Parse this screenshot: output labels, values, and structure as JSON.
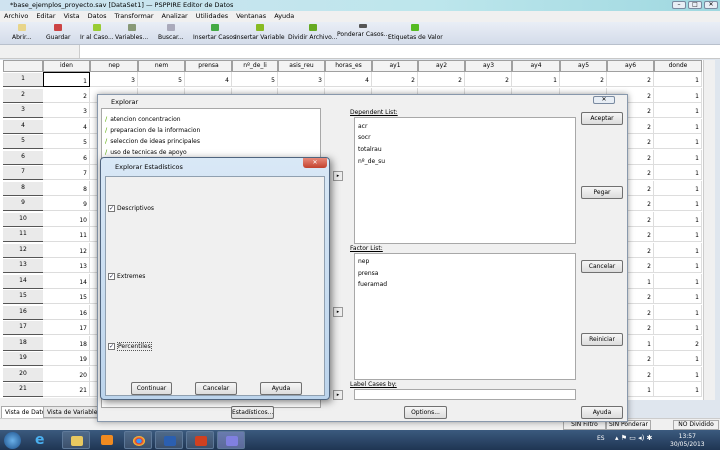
{
  "window": {
    "title": "*base_ejemplos_proyecto.sav [DataSet1] — PSPPIRE Editor de Datos"
  },
  "menu": [
    "Archivo",
    "Editar",
    "Vista",
    "Datos",
    "Transformar",
    "Analizar",
    "Utilidades",
    "Ventanas",
    "Ayuda"
  ],
  "toolbar": [
    "Abrir...",
    "Guardar",
    "Ir al Caso...",
    "Variables...",
    "Buscar...",
    "Insertar Casos",
    "Insertar Variable",
    "Dividir Archivo...",
    "Ponderar Casos...",
    "Etiquetas de Valor"
  ],
  "grid": {
    "columns": [
      "iden",
      "nep",
      "nem",
      "prensa",
      "nº_de_li",
      "asis_reu",
      "horas_es",
      "ay1",
      "ay2",
      "ay3",
      "ay4",
      "ay5",
      "ay6",
      "donde"
    ],
    "row1": [
      "1",
      "3",
      "5",
      "4",
      "5",
      "3",
      "4",
      "2",
      "2",
      "2",
      "1",
      "2",
      "2",
      "1"
    ],
    "rows": [
      "1",
      "2",
      "3",
      "4",
      "5",
      "6",
      "7",
      "8",
      "9",
      "10",
      "11",
      "12",
      "13",
      "14",
      "15",
      "16",
      "17",
      "18",
      "19",
      "20",
      "21"
    ],
    "ay6": [
      "2",
      "2",
      "2",
      "2",
      "2",
      "2",
      "2",
      "2",
      "2",
      "2",
      "2",
      "2",
      "2",
      "1",
      "2",
      "2",
      "2",
      "1",
      "2",
      "2",
      "1"
    ],
    "donde": [
      "1",
      "1",
      "1",
      "1",
      "1",
      "1",
      "1",
      "1",
      "1",
      "1",
      "1",
      "1",
      "1",
      "1",
      "1",
      "1",
      "1",
      "2",
      "1",
      "1",
      "1"
    ]
  },
  "tabs": [
    "Vista de Datos",
    "Vista de Variables"
  ],
  "status": [
    "SIN Filtro",
    "SIN Ponderar",
    "NO Dividido"
  ],
  "explorar": {
    "title": "Explorar",
    "variables": [
      "atencion concentracion",
      "preparacion de la informacion",
      "seleccion de ideas principales",
      "uso de tecnicas de apoyo"
    ],
    "dependent_label": "Dependent List:",
    "dependent": [
      "acr",
      "socr",
      "totalrau",
      "nº_de_su"
    ],
    "factor_label": "Factor List:",
    "factor": [
      "nep",
      "prensa",
      "fueramad"
    ],
    "label_cases": "Label Cases by:",
    "buttons": {
      "aceptar": "Aceptar",
      "pegar": "Pegar",
      "cancelar": "Cancelar",
      "reiniciar": "Reiniciar",
      "ayuda": "Ayuda",
      "options": "Options...",
      "estadisticos": "Estadísticos..."
    }
  },
  "stats": {
    "title": "Explorar Estadísticos",
    "descriptivos": "Descriptivos",
    "extremes": "Extremes",
    "percentiles": "Percentiles",
    "checked": [
      true,
      true,
      true
    ],
    "continuar": "Continuar",
    "cancelar": "Cancelar",
    "ayuda": "Ayuda"
  },
  "tray": {
    "lang": "ES",
    "time": "13:57",
    "date": "30/05/2013"
  }
}
